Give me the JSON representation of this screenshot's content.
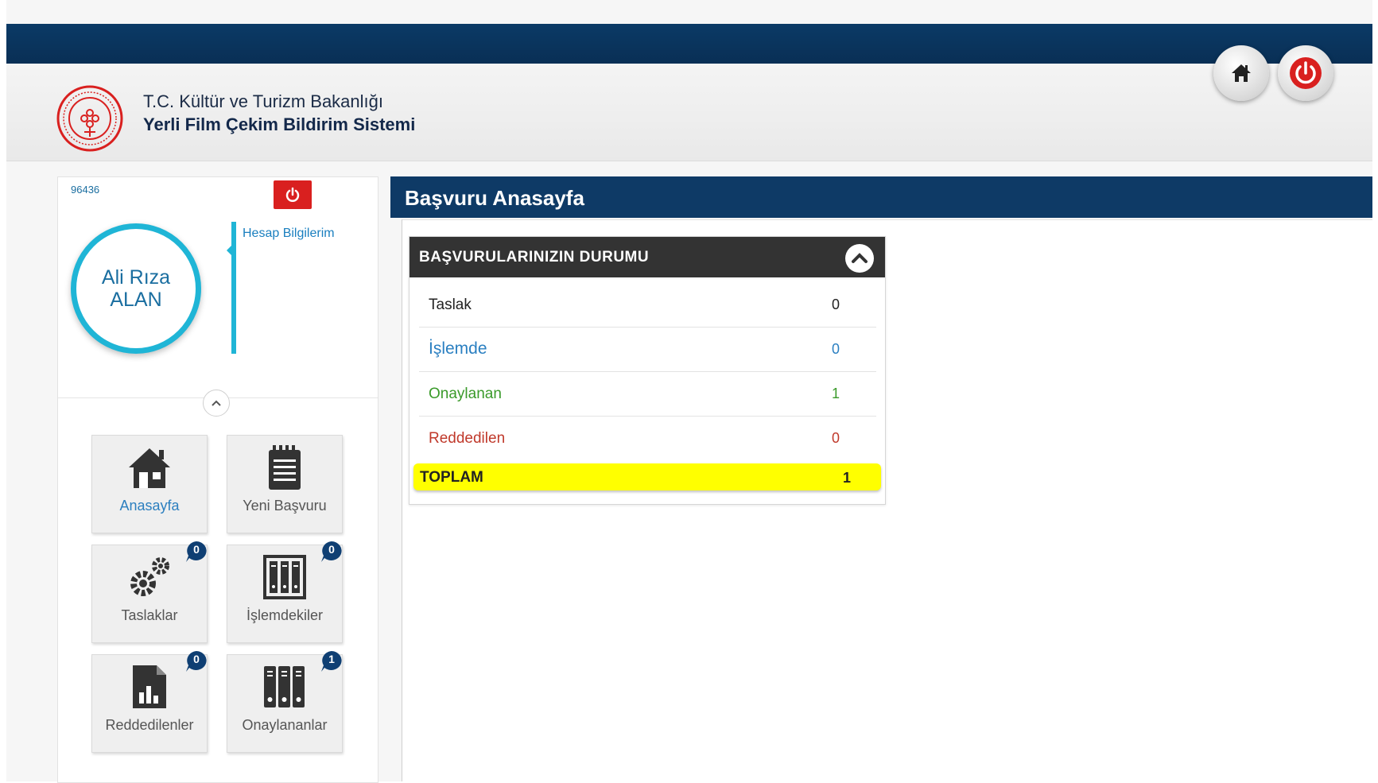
{
  "header": {
    "org_name": "T.C. Kültür ve Turizm Bakanlığı",
    "system_name": "Yerli Film Çekim Bildirim Sistemi"
  },
  "user": {
    "code": "96436",
    "first_name": "Ali Rıza",
    "last_name": "ALAN",
    "account_link": "Hesap Bilgilerim"
  },
  "tiles": [
    {
      "label": "Anasayfa"
    },
    {
      "label": "Yeni Başvuru"
    },
    {
      "label": "Taslaklar",
      "badge": "0"
    },
    {
      "label": "İşlemdekiler",
      "badge": "0"
    },
    {
      "label": "Reddedilenler",
      "badge": "0"
    },
    {
      "label": "Onaylananlar",
      "badge": "1"
    }
  ],
  "page": {
    "title": "Başvuru Anasayfa"
  },
  "status_panel": {
    "title": "BAŞVURULARINIZIN DURUMU",
    "rows": [
      {
        "label": "Taslak",
        "value": "0",
        "color": "#222222"
      },
      {
        "label": "İşlemde",
        "value": "0",
        "color": "#2a7fc1"
      },
      {
        "label": "Onaylanan",
        "value": "1",
        "color": "#3a9a2a"
      },
      {
        "label": "Reddedilen",
        "value": "0",
        "color": "#c0392b"
      }
    ],
    "total": {
      "label": "TOPLAM",
      "value": "1",
      "highlight": "#ffff00"
    }
  },
  "colors": {
    "navy": "#0e3a66",
    "accent_cyan": "#1fb5d6",
    "danger_red": "#d9201f",
    "badge_blue": "#0f3f73"
  }
}
